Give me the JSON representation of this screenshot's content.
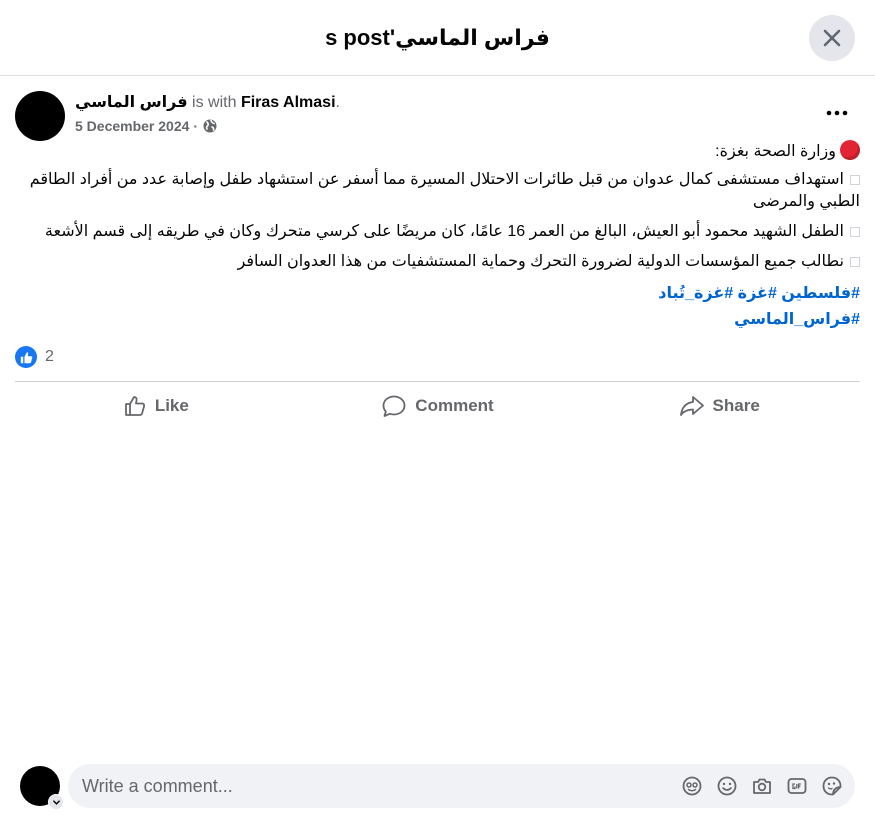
{
  "header": {
    "title": "فراس الماسي's post"
  },
  "post": {
    "author": "فراس الماسي",
    "with_text": "is with",
    "tagged": "Firas Almasi",
    "period": ".",
    "date": "5 December 2024",
    "date_sep": "·",
    "privacy_icon": "globe-icon",
    "heading": "وزارة الصحة بغزة:",
    "paragraphs": [
      "استهداف مستشفى كمال عدوان من قبل طائرات الاحتلال المسيرة مما أسفر عن استشهاد طفل وإصابة عدد من أفراد الطاقم الطبي والمرضى",
      "الطفل الشهيد محمود أبو العيش، البالغ من العمر 16 عامًا، كان مريضًا على كرسي متحرك وكان في طريقه إلى قسم الأشعة",
      "نطالب جميع المؤسسات الدولية لضرورة التحرك وحماية المستشفيات من هذا العدوان السافر"
    ],
    "hashtags": [
      "#فلسطين #غزة #غزة_تُباد",
      "#فراس_الماسي"
    ],
    "reaction_count": "2"
  },
  "actions": {
    "like": "Like",
    "comment": "Comment",
    "share": "Share"
  },
  "comment_box": {
    "placeholder": "Write a comment..."
  },
  "colors": {
    "link": "#0064d1",
    "brand": "#1877f2",
    "muted": "#65676b"
  }
}
